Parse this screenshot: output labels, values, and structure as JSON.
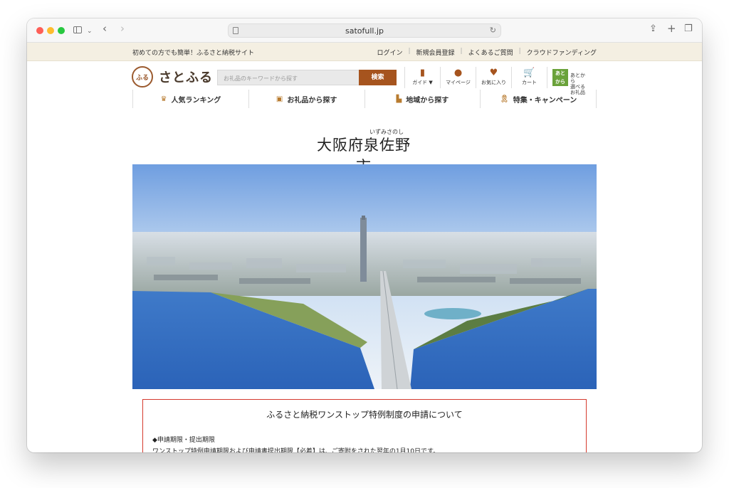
{
  "browser": {
    "url": "satofull.jp"
  },
  "topstrip": {
    "tagline": "初めての方でも簡単！ふるさと納税サイト",
    "links": [
      "ログイン",
      "新規会員登録",
      "よくあるご質問",
      "クラウドファンディング"
    ]
  },
  "header": {
    "logo_mark": "ふる\nさと",
    "logo_text": "さとふる",
    "search_placeholder": "お礼品のキーワードから探す",
    "search_button": "検索",
    "icons": [
      {
        "label": "ガイド ▼",
        "icon": "book-icon"
      },
      {
        "label": "マイページ",
        "icon": "person-icon"
      },
      {
        "label": "お気に入り",
        "icon": "heart-icon"
      },
      {
        "label": "カート",
        "icon": "cart-icon"
      }
    ],
    "atokara": {
      "mark": "あと\nから",
      "text": "あとから\n選べるお礼品"
    }
  },
  "nav": [
    {
      "label": "人気ランキング",
      "icon": "crown-icon"
    },
    {
      "label": "お礼品から探す",
      "icon": "gift-icon"
    },
    {
      "label": "地域から探す",
      "icon": "map-icon"
    },
    {
      "label": "特集・キャンペーン",
      "icon": "ribbon-icon"
    }
  ],
  "city": {
    "ruby": "いずみさのし",
    "title": "大阪府泉佐野市"
  },
  "notice": {
    "title": "ふるさと納税ワンストップ特例制度の申請について",
    "heading": "◆申請期限・提出期限",
    "body": "ワンストップ特例申請期限および申請書提出期限【必着】は、ご寄附をされた翌年の1月10日です。"
  },
  "colors": {
    "accent": "#a6541e",
    "strip_bg": "#f4efe2",
    "notice_border": "#d53a2e"
  }
}
